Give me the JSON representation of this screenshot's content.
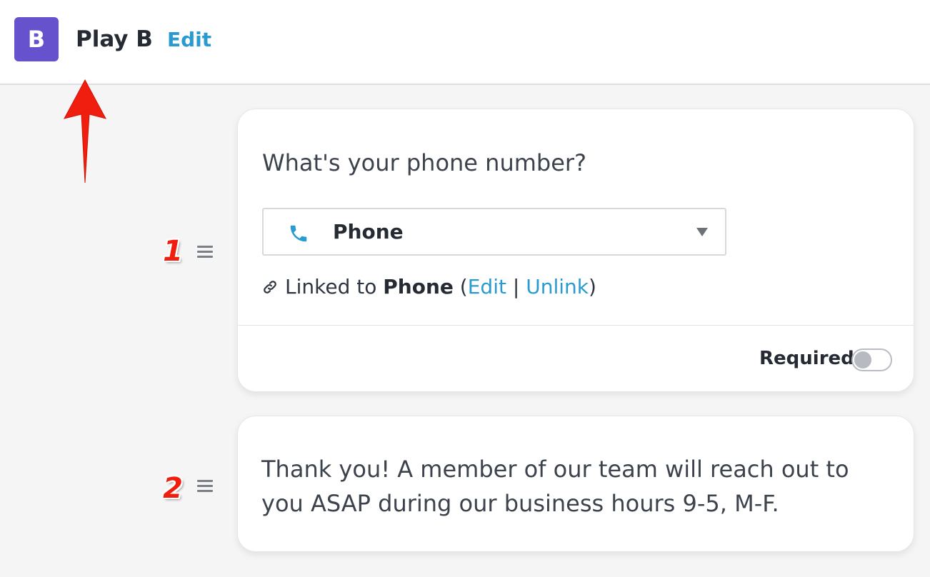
{
  "header": {
    "avatar_letter": "B",
    "title": "Play B",
    "edit_label": "Edit",
    "avatar_color": "#6552cc",
    "link_color": "#2a9bd0"
  },
  "annotations": {
    "step_1": "1",
    "step_2": "2",
    "arrow_color": "#f01e0e"
  },
  "steps": [
    {
      "question": "What's your phone number?",
      "select": {
        "icon": "phone-icon",
        "value": "Phone"
      },
      "linked": {
        "prefix": "Linked to",
        "field": "Phone",
        "open_paren": "(",
        "edit_label": "Edit",
        "separator": "|",
        "unlink_label": "Unlink",
        "close_paren": ")"
      },
      "required_label": "Required",
      "required": false
    },
    {
      "message": "Thank you! A member of our team will reach out to you ASAP during our business hours 9-5, M-F."
    }
  ]
}
